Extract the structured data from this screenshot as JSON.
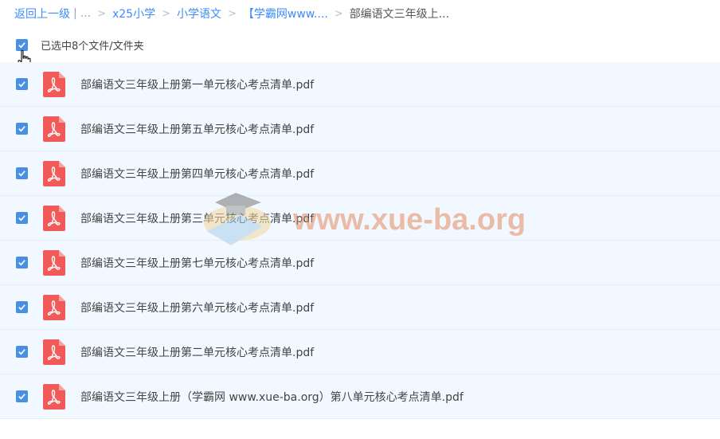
{
  "breadcrumb": {
    "back_label": "返回上一级",
    "pipe": "|",
    "ellipsis": "...",
    "items": [
      "x25小学",
      "小学语文",
      "【学霸网www....",
      "部编语文三年级上..."
    ]
  },
  "selection": {
    "text": "已选中8个文件/文件夹",
    "checked": true
  },
  "files": [
    {
      "name": "部编语文三年级上册第一单元核心考点清单.pdf",
      "checked": true
    },
    {
      "name": "部编语文三年级上册第五单元核心考点清单.pdf",
      "checked": true
    },
    {
      "name": "部编语文三年级上册第四单元核心考点清单.pdf",
      "checked": true
    },
    {
      "name": "部编语文三年级上册第三单元核心考点清单.pdf",
      "checked": true
    },
    {
      "name": "部编语文三年级上册第七单元核心考点清单.pdf",
      "checked": true
    },
    {
      "name": "部编语文三年级上册第六单元核心考点清单.pdf",
      "checked": true
    },
    {
      "name": "部编语文三年级上册第二单元核心考点清单.pdf",
      "checked": true
    },
    {
      "name": "部编语文三年级上册（学霸网 www.xue-ba.org）第八单元核心考点清单.pdf",
      "checked": true
    }
  ],
  "watermark": {
    "text": "www.xue-ba.org",
    "color": "#e58a5e"
  },
  "colors": {
    "accent": "#3b8cff",
    "checkbox": "#4a90e2",
    "pdf_icon": "#f25a5a",
    "row_bg": "#f2f8ff"
  }
}
